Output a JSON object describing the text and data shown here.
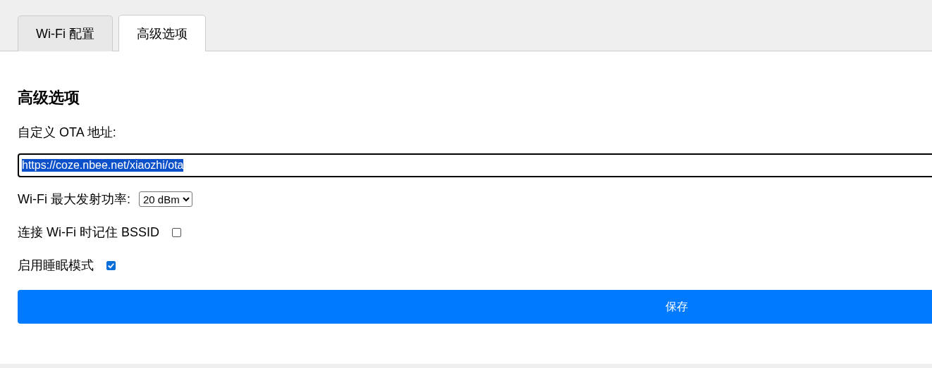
{
  "tabs": [
    {
      "label": "Wi-Fi 配置",
      "selected": false
    },
    {
      "label": "高级选项",
      "selected": true
    }
  ],
  "section": {
    "title": "高级选项",
    "ota_label": "自定义 OTA 地址:",
    "ota_field": {
      "value": "https://coze.nbee.net/xiaozhi/ota",
      "text_selected": true
    },
    "power_label": "Wi-Fi 最大发射功率:",
    "power_select": {
      "value": "20 dBm"
    },
    "options": [
      {
        "label": "连接 Wi-Fi 时记住 BSSID",
        "checked": false
      },
      {
        "label": "启用睡眠模式",
        "checked": true
      }
    ],
    "save_button": "保存"
  }
}
